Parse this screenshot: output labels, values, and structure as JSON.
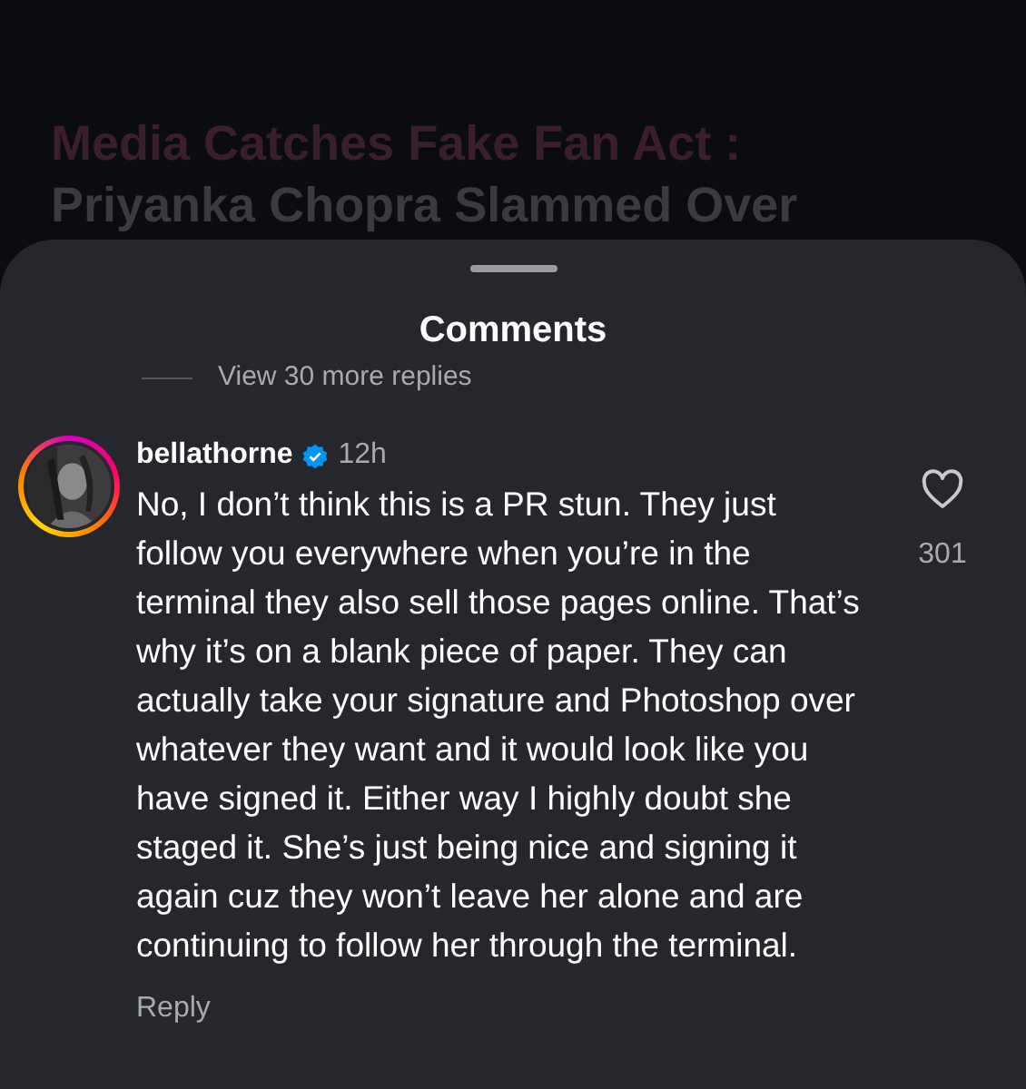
{
  "background_post": {
    "headline_lines": [
      "Media Catches Fake Fan Act :",
      "Priyanka Chopra Slammed Over"
    ]
  },
  "sheet": {
    "title": "Comments",
    "view_more_replies": "View 30 more replies"
  },
  "comment": {
    "username": "bellathorne",
    "verified": true,
    "time": "12h",
    "text": "No, I don’t think this is a PR stun. They just follow you everywhere when you’re in the terminal they also sell those pages online. That’s why it’s on a blank piece of paper. They can actually take your signature and Photoshop over whatever they want and it would look like you have signed it. Either way I highly doubt she staged it. She’s just being nice and signing it again cuz they won’t leave her alone and are continuing to follow her through the terminal.",
    "liked": false,
    "like_count": "301",
    "reply_label": "Reply"
  }
}
